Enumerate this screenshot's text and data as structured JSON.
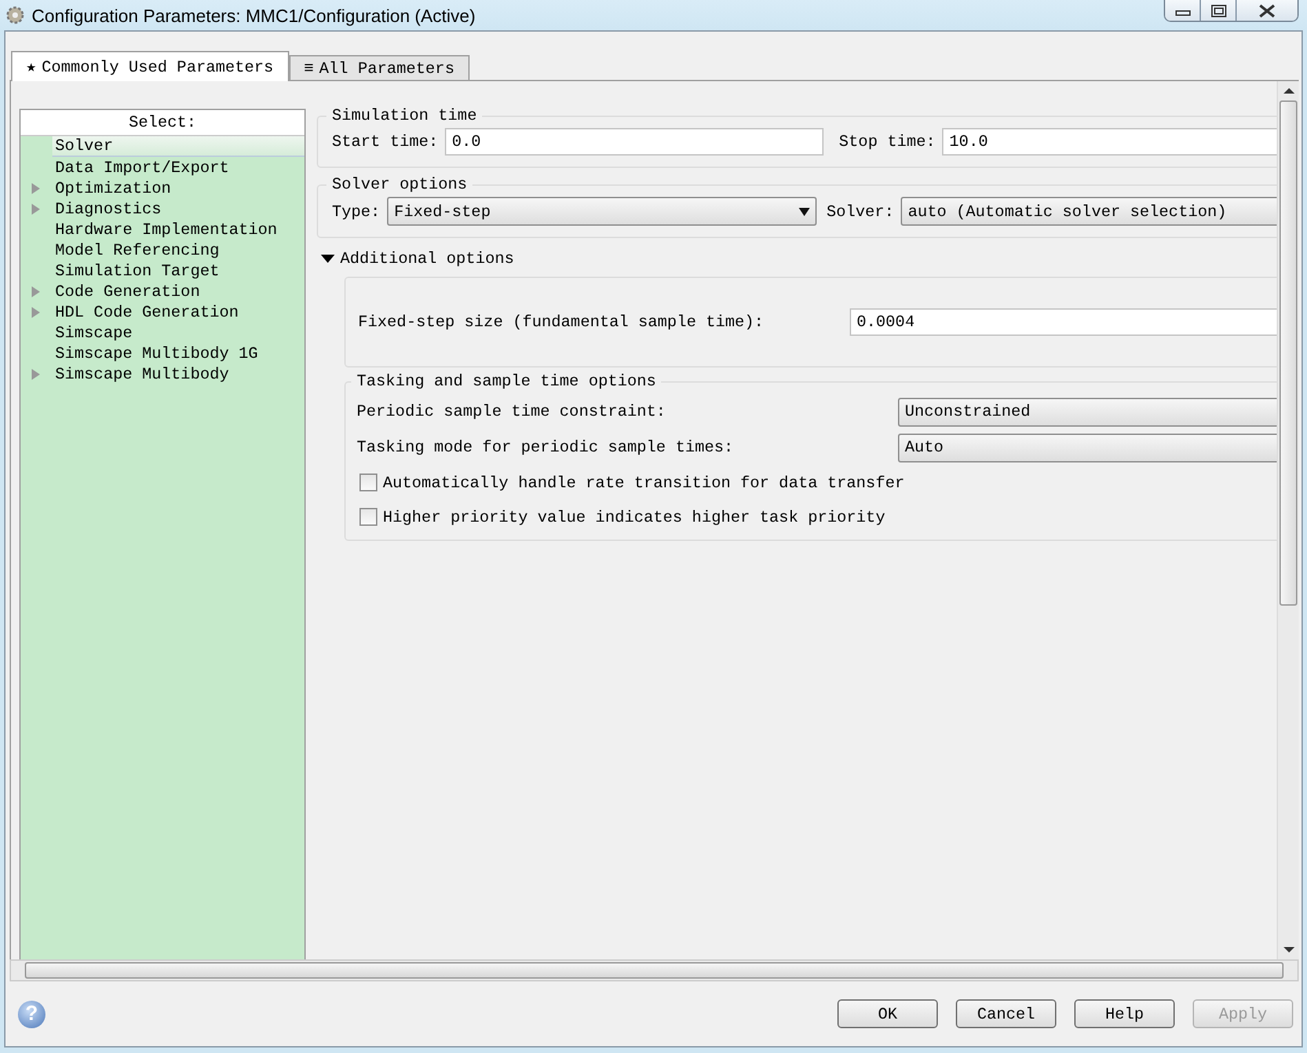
{
  "window": {
    "title": "Configuration Parameters: MMC1/Configuration (Active)"
  },
  "tabs": [
    {
      "icon": "★",
      "label": "Commonly Used Parameters",
      "selected": true
    },
    {
      "icon": "≡",
      "label": "All Parameters",
      "selected": false
    }
  ],
  "sidebar": {
    "header": "Select:",
    "items": [
      {
        "label": "Solver",
        "expandable": false,
        "selected": true
      },
      {
        "label": "Data Import/Export",
        "expandable": false,
        "selected": false
      },
      {
        "label": "Optimization",
        "expandable": true,
        "selected": false
      },
      {
        "label": "Diagnostics",
        "expandable": true,
        "selected": false
      },
      {
        "label": "Hardware Implementation",
        "expandable": false,
        "selected": false
      },
      {
        "label": "Model Referencing",
        "expandable": false,
        "selected": false
      },
      {
        "label": "Simulation Target",
        "expandable": false,
        "selected": false
      },
      {
        "label": "Code Generation",
        "expandable": true,
        "selected": false
      },
      {
        "label": "HDL Code Generation",
        "expandable": true,
        "selected": false
      },
      {
        "label": "Simscape",
        "expandable": false,
        "selected": false
      },
      {
        "label": "Simscape Multibody 1G",
        "expandable": false,
        "selected": false
      },
      {
        "label": "Simscape Multibody",
        "expandable": true,
        "selected": false
      }
    ]
  },
  "simulation_time": {
    "title": "Simulation time",
    "start_label": "Start time:",
    "start_value": "0.0",
    "stop_label": "Stop time:",
    "stop_value": "10.0"
  },
  "solver_options": {
    "title": "Solver options",
    "type_label": "Type:",
    "type_value": "Fixed-step",
    "solver_label": "Solver:",
    "solver_value": "auto (Automatic solver selection)"
  },
  "additional_options": {
    "title": "Additional options",
    "expanded": true,
    "step_label": "Fixed-step size (fundamental sample time):",
    "step_value": "0.0004",
    "tasking": {
      "title": "Tasking and sample time options",
      "rows": [
        {
          "kind": "dropdown",
          "label": "Periodic sample time constraint:",
          "value": "Unconstrained"
        },
        {
          "kind": "dropdown",
          "label": "Tasking mode for periodic sample times:",
          "value": "Auto"
        },
        {
          "kind": "checkbox",
          "label": "Automatically handle rate transition for data transfer",
          "checked": false
        },
        {
          "kind": "checkbox",
          "label": "Higher priority value indicates higher task priority",
          "checked": false
        }
      ]
    }
  },
  "footer": {
    "help": "?",
    "buttons": [
      {
        "label": "OK",
        "disabled": false
      },
      {
        "label": "Cancel",
        "disabled": false
      },
      {
        "label": "Help",
        "disabled": false
      },
      {
        "label": "Apply",
        "disabled": true
      }
    ]
  }
}
